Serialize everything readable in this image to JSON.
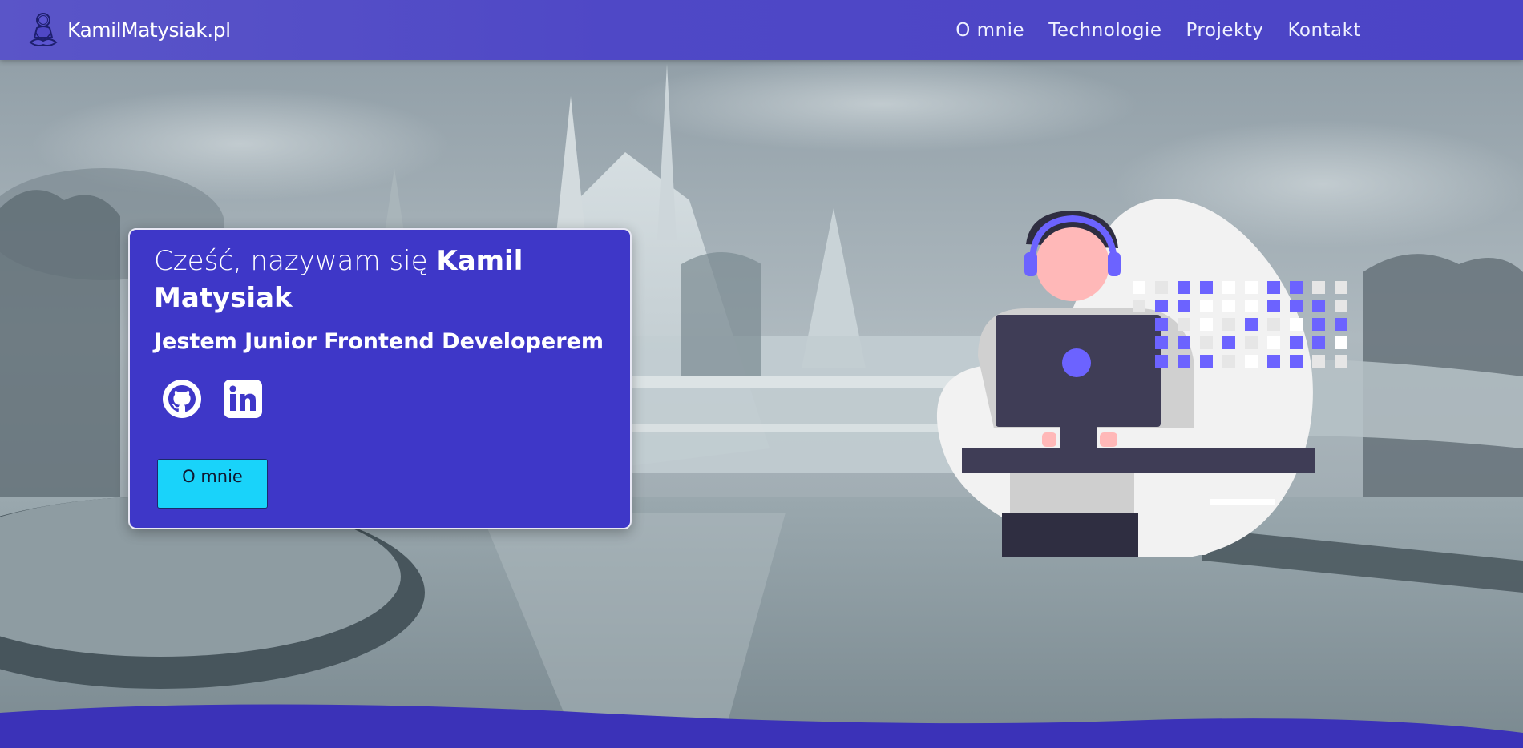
{
  "brand": {
    "name": "KamilMatysiak.pl",
    "logo_icon": "meditating-person-icon"
  },
  "nav": {
    "items": [
      {
        "label": "O mnie"
      },
      {
        "label": "Technologie"
      },
      {
        "label": "Projekty"
      },
      {
        "label": "Kontakt"
      }
    ]
  },
  "hero": {
    "greeting_prefix": "Cześć, nazywam się ",
    "greeting_name": "Kamil Matysiak",
    "role": "Jestem Junior Frontend Developerem",
    "socials": [
      {
        "icon": "github-icon"
      },
      {
        "icon": "linkedin-icon"
      }
    ],
    "cta_label": "O mnie",
    "illustration_icon": "developer-with-headphones-icon"
  },
  "colors": {
    "nav_background": "#4f48c6",
    "card_background": "#3e37c8",
    "button_background": "#19d3fa",
    "accent_purple": "#6c63ff",
    "bottom_wave": "#3b32b8"
  }
}
